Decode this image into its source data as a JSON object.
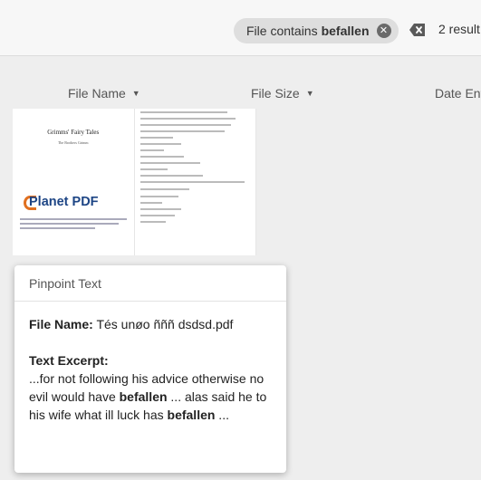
{
  "filter_chip": {
    "prefix": "File contains",
    "term": "befallen"
  },
  "results_label": "2 result",
  "columns": [
    {
      "label": "File Name"
    },
    {
      "label": "File Size"
    },
    {
      "label": "Date Ent"
    }
  ],
  "thumbnail": {
    "title": "Grimms' Fairy Tales",
    "author": "The Brothers Grimm",
    "logo": "Planet PDF"
  },
  "popup": {
    "title": "Pinpoint Text",
    "file_name_label": "File Name:",
    "file_name": "Tés unøo ñññ dsdsd.pdf",
    "excerpt_label": "Text Excerpt:",
    "excerpt_1": "...for not following his advice otherwise no evil would have ",
    "highlight_1": "befallen",
    "excerpt_2": " ... alas said he to his wife what ill luck has ",
    "highlight_2": "befallen",
    "excerpt_3": " ..."
  }
}
